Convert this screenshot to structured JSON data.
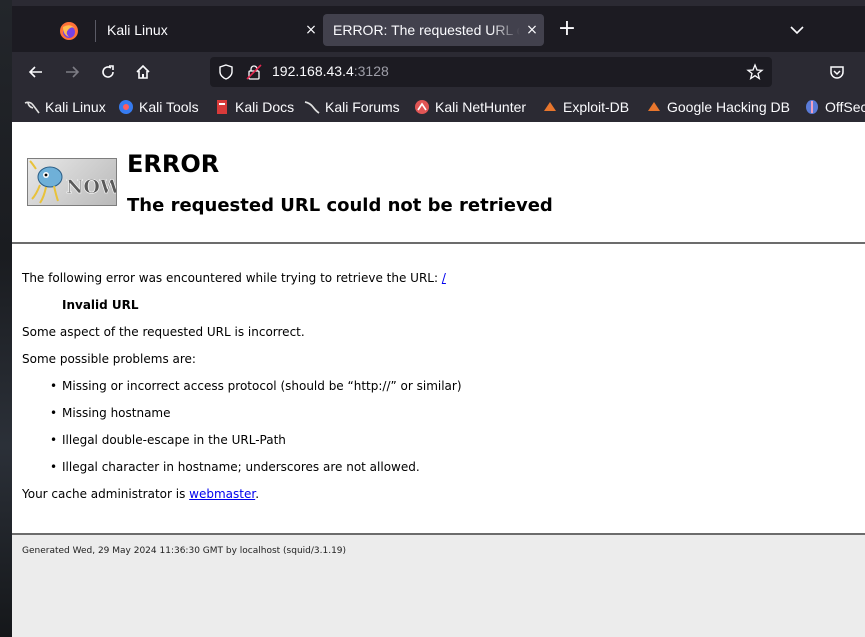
{
  "tabs": [
    {
      "label": "Kali Linux",
      "close": "×"
    },
    {
      "label": "ERROR: The requested URL could not be retrieved",
      "close": "×"
    }
  ],
  "new_tab": "+",
  "address_bar": {
    "host": "192.168.43.4",
    "port": ":3128"
  },
  "bookmarks": [
    {
      "label": "Kali Linux",
      "icon": "kali-dragon-icon"
    },
    {
      "label": "Kali Tools",
      "icon": "kali-tools-icon"
    },
    {
      "label": "Kali Docs",
      "icon": "kali-docs-icon"
    },
    {
      "label": "Kali Forums",
      "icon": "kali-forums-icon"
    },
    {
      "label": "Kali NetHunter",
      "icon": "kali-nethunter-icon"
    },
    {
      "label": "Exploit-DB",
      "icon": "exploit-db-icon"
    },
    {
      "label": "Google Hacking DB",
      "icon": "ghdb-icon"
    },
    {
      "label": "OffSec",
      "icon": "offsec-icon"
    }
  ],
  "page": {
    "logo_text": "NOW",
    "title": "ERROR",
    "subtitle": "The requested URL could not be retrieved",
    "intro": "The following error was encountered while trying to retrieve the URL: ",
    "url_link": "/",
    "error_name": "Invalid URL",
    "description": "Some aspect of the requested URL is incorrect.",
    "problems_heading": "Some possible problems are:",
    "problems": [
      "Missing or incorrect access protocol (should be “http://” or similar)",
      "Missing hostname",
      "Illegal double-escape in the URL-Path",
      "Illegal character in hostname; underscores are not allowed."
    ],
    "admin_text": "Your cache administrator is ",
    "admin_link": "webmaster",
    "admin_suffix": ".",
    "footer": "Generated Wed, 29 May 2024 11:36:30 GMT by localhost (squid/3.1.19)"
  },
  "colors": {
    "link": "#0000ee",
    "tab_active": "#42414d",
    "toolbar": "#2b2a33"
  }
}
